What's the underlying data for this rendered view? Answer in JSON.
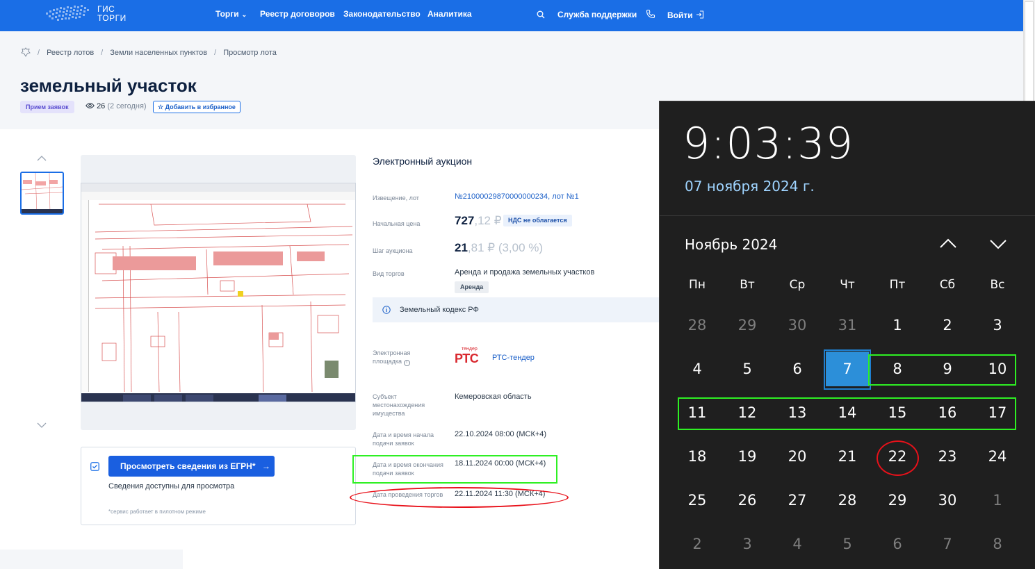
{
  "header": {
    "logo_line1": "ГИС",
    "logo_line2": "ТОРГИ",
    "nav": [
      "Торги",
      "Реестр договоров",
      "Законодательство",
      "Аналитика"
    ],
    "support": "Служба поддержки",
    "login": "Войти",
    "color": "#1a6ee6"
  },
  "breadcrumbs": [
    "Реестр лотов",
    "Земли населенных пунктов",
    "Просмотр лота"
  ],
  "lot": {
    "title": "земельный участок",
    "status": "Прием заявок",
    "views": "26",
    "views_today": "(2 сегодня)",
    "favorite": "Добавить в избранное"
  },
  "egrn": {
    "button": "Просмотреть сведения из ЕГРН*",
    "note": "Сведения доступны для просмотра",
    "pilot": "*сервис работает в пилотном режиме"
  },
  "details": {
    "auction_type": "Электронный аукцион",
    "notice_label": "Извещение, лот",
    "notice_value": "№21000029870000000234, лот №1",
    "start_price_label": "Начальная цена",
    "start_price_main": "727",
    "start_price_rest": ",12 ₽",
    "vat": "НДС не облагается",
    "step_label": "Шаг аукциона",
    "step_main": "21",
    "step_rest": ",81 ₽ (3,00 %)",
    "trade_kind_label": "Вид торгов",
    "trade_kind_value": "Аренда и продажа земельных участков",
    "trade_kind_badge": "Аренда",
    "law": "Земельный кодекс РФ",
    "platform_label_1": "Электронная",
    "platform_label_2": "площадка",
    "platform_logo_top": "тендер",
    "platform_logo": "РТС",
    "platform_value": "РТС-тендер",
    "subject_label_1": "Субъект",
    "subject_label_2": "местонахождения",
    "subject_label_3": "имущества",
    "subject_value": "Кемеровская область",
    "start_label_1": "Дата и время начала",
    "start_label_2": "подачи заявок",
    "start_value": "22.10.2024 08:00 (МСК+4)",
    "end_label_1": "Дата и время окончания",
    "end_label_2": "подачи заявок",
    "end_value": "18.11.2024 00:00 (МСК+4)",
    "trade_label": "Дата проведения торгов",
    "trade_value": "22.11.2024 11:30 (МСК+4)"
  },
  "calendar": {
    "time": "9:03:39",
    "date": "07 ноября 2024 г.",
    "month": "Ноябрь 2024",
    "weekdays": [
      "Пн",
      "Вт",
      "Ср",
      "Чт",
      "Пт",
      "Сб",
      "Вс"
    ],
    "weeks": [
      [
        "28",
        "29",
        "30",
        "31",
        "1",
        "2",
        "3"
      ],
      [
        "4",
        "5",
        "6",
        "7",
        "8",
        "9",
        "10"
      ],
      [
        "11",
        "12",
        "13",
        "14",
        "15",
        "16",
        "17"
      ],
      [
        "18",
        "19",
        "20",
        "21",
        "22",
        "23",
        "24"
      ],
      [
        "25",
        "26",
        "27",
        "28",
        "29",
        "30",
        "1"
      ],
      [
        "2",
        "3",
        "4",
        "5",
        "6",
        "7",
        "8"
      ]
    ],
    "today": "7",
    "accent": "#2c8fd9"
  }
}
